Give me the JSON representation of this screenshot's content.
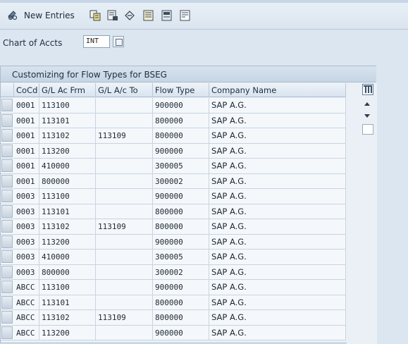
{
  "toolbar": {
    "new_entries_label": "New Entries",
    "icons": [
      "edit-glasses-icon",
      "copy-icon",
      "delete-icon",
      "undo-icon",
      "select-all-icon",
      "select-block-icon",
      "deselect-all-icon"
    ]
  },
  "filter": {
    "label": "Chart of Accts",
    "value": "INT"
  },
  "table": {
    "title": "Customizing for Flow Types for BSEG",
    "columns": [
      "CoCd",
      "G/L Ac Frm",
      "G/L A/c To",
      "Flow Type",
      "Company Name"
    ],
    "rows": [
      {
        "cocd": "0001",
        "from": "113100",
        "to": "",
        "flow": "900000",
        "company": "SAP A.G."
      },
      {
        "cocd": "0001",
        "from": "113101",
        "to": "",
        "flow": "800000",
        "company": "SAP A.G."
      },
      {
        "cocd": "0001",
        "from": "113102",
        "to": "113109",
        "flow": "800000",
        "company": "SAP A.G."
      },
      {
        "cocd": "0001",
        "from": "113200",
        "to": "",
        "flow": "900000",
        "company": "SAP A.G."
      },
      {
        "cocd": "0001",
        "from": "410000",
        "to": "",
        "flow": "300005",
        "company": "SAP A.G."
      },
      {
        "cocd": "0001",
        "from": "800000",
        "to": "",
        "flow": "300002",
        "company": "SAP A.G."
      },
      {
        "cocd": "0003",
        "from": "113100",
        "to": "",
        "flow": "900000",
        "company": "SAP A.G."
      },
      {
        "cocd": "0003",
        "from": "113101",
        "to": "",
        "flow": "800000",
        "company": "SAP A.G."
      },
      {
        "cocd": "0003",
        "from": "113102",
        "to": "113109",
        "flow": "800000",
        "company": "SAP A.G."
      },
      {
        "cocd": "0003",
        "from": "113200",
        "to": "",
        "flow": "900000",
        "company": "SAP A.G."
      },
      {
        "cocd": "0003",
        "from": "410000",
        "to": "",
        "flow": "300005",
        "company": "SAP A.G."
      },
      {
        "cocd": "0003",
        "from": "800000",
        "to": "",
        "flow": "300002",
        "company": "SAP A.G."
      },
      {
        "cocd": "ABCC",
        "from": "113100",
        "to": "",
        "flow": "900000",
        "company": "SAP A.G."
      },
      {
        "cocd": "ABCC",
        "from": "113101",
        "to": "",
        "flow": "800000",
        "company": "SAP A.G."
      },
      {
        "cocd": "ABCC",
        "from": "113102",
        "to": "113109",
        "flow": "800000",
        "company": "SAP A.G."
      },
      {
        "cocd": "ABCC",
        "from": "113200",
        "to": "",
        "flow": "900000",
        "company": "SAP A.G."
      }
    ]
  }
}
